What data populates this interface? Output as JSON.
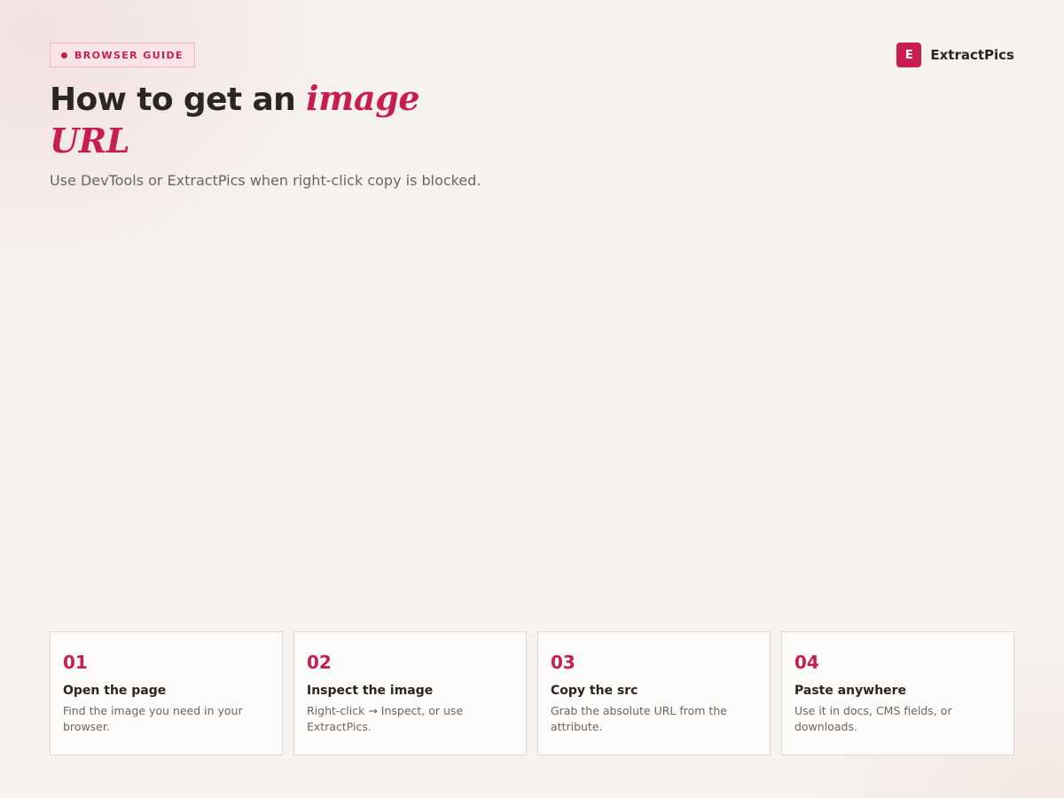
{
  "badge": {
    "label": "BROWSER GUIDE"
  },
  "brand": {
    "mark": "E",
    "name": "ExtractPics"
  },
  "header": {
    "title_plain": "How to get an ",
    "title_accent": "image URL",
    "subtitle": "Use DevTools or ExtractPics when right-click copy is blocked."
  },
  "steps": [
    {
      "number": "01",
      "title": "Open the page",
      "description": "Find the image you need in your browser."
    },
    {
      "number": "02",
      "title": "Inspect the image",
      "description": "Right-click → Inspect, or use ExtractPics."
    },
    {
      "number": "03",
      "title": "Copy the src",
      "description": "Grab the absolute URL from the attribute."
    },
    {
      "number": "04",
      "title": "Paste anywhere",
      "description": "Use it in docs, CMS fields, or downloads."
    }
  ],
  "colors": {
    "accent": "#c81e4f",
    "background": "#f6f3ef",
    "text": "#2a2622",
    "muted": "#6b6560"
  }
}
